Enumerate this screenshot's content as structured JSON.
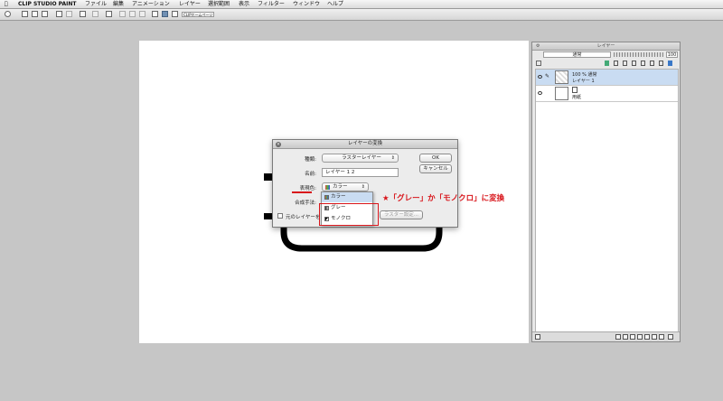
{
  "menubar": {
    "app_name": "CLIP STUDIO PAINT",
    "items": [
      "ファイル",
      "編集",
      "アニメーション",
      "レイヤー",
      "選択範囲",
      "表示",
      "フィルター",
      "ウィンドウ",
      "ヘルプ"
    ]
  },
  "toolbar": {
    "url_label": "CLIPホームページ"
  },
  "dialog": {
    "title": "レイヤーの変換",
    "type_label": "種類:",
    "type_value": "ラスターレイヤー",
    "name_label": "名前:",
    "name_value": "レイヤー 1 2",
    "color_label": "表現色:",
    "color_value": "カラー",
    "blend_label": "合成手法:",
    "keep_original_label": "元のレイヤーを残す",
    "settings_button": "ラスター設定...",
    "ok_button": "OK",
    "cancel_button": "キャンセル",
    "color_options": [
      "カラー",
      "グレー",
      "モノクロ"
    ]
  },
  "annotation": "★「グレー」か「モノクロ」に変換",
  "layer_panel": {
    "title": "レイヤー",
    "blend_mode": "通常",
    "opacity": "100",
    "layers": [
      {
        "name_line1": "100 % 通常",
        "name_line2": "レイヤー 1",
        "selected": true
      },
      {
        "name_line1": "",
        "name_line2": "用紙",
        "selected": false
      }
    ]
  },
  "colors": {
    "annotation_red": "#d8141a",
    "selection_blue": "#c9dcf2"
  }
}
